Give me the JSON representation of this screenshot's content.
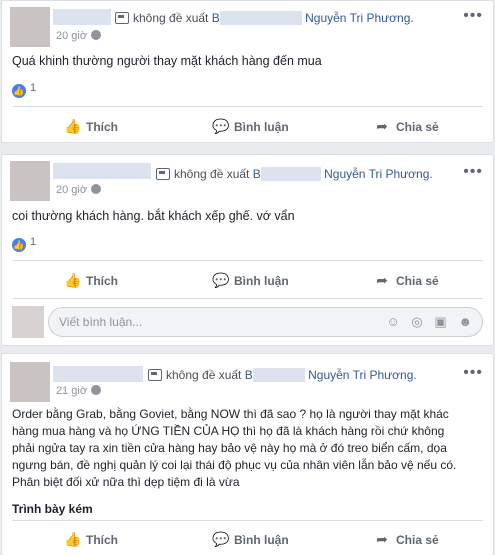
{
  "posts": [
    {
      "recommend": "không đề xuất",
      "page_prefix": "B",
      "page_suffix": "Nguyễn Tri Phương.",
      "time": "20 giờ",
      "text": "Quá khinh thường người thay mặt khách hàng đến mua",
      "reactions": "1",
      "actions": {
        "like": "Thích",
        "comment": "Bình luận",
        "share": "Chia sẻ"
      }
    },
    {
      "recommend": "không đề xuất",
      "page_prefix": "B",
      "page_suffix": "Nguyễn Tri Phương.",
      "time": "20 giờ",
      "text": "coi thường khách hàng. bắt khách xếp ghế. vớ vẩn",
      "reactions": "1",
      "actions": {
        "like": "Thích",
        "comment": "Bình luận",
        "share": "Chia sẻ"
      },
      "comment_placeholder": "Viết bình luận..."
    },
    {
      "recommend": "không đề xuất",
      "page_prefix": "B",
      "page_suffix": "Nguyễn Tri Phương.",
      "time": "21 giờ",
      "text_lines": [
        "Order bằng Grab, bằng Goviet, bằng NOW thì đã sao ? họ là người thay mặt khác",
        "hàng mua hàng và họ ỨNG TIỀN CỦA HỌ thì họ đã là khách hàng rồi chứ không",
        "phải ngửa tay ra xin tiền cửa hàng hay bảo vệ này họ mà ở đó treo biển cấm, dọa",
        "ngưng bán, đề nghị quản lý coi lại thái độ phục vụ của nhân viên lẫn bảo vệ nếu có.",
        "Phân biệt đối xử nữa thì dẹp tiệm đi là vừa"
      ],
      "bold_line": "Trình bày kém",
      "actions": {
        "like": "Thích",
        "comment": "Bình luận",
        "share": "Chia sẻ"
      }
    }
  ],
  "icons": {
    "like": "thumbs-up-icon",
    "comment": "comment-bubble-icon",
    "share": "share-arrow-icon",
    "more": "more-options-icon",
    "page": "page-icon",
    "globe": "globe-icon"
  },
  "colors": {
    "link": "#365899",
    "muted": "#606770",
    "like_badge": "#4a7cf0",
    "background": "#e9ebee"
  }
}
